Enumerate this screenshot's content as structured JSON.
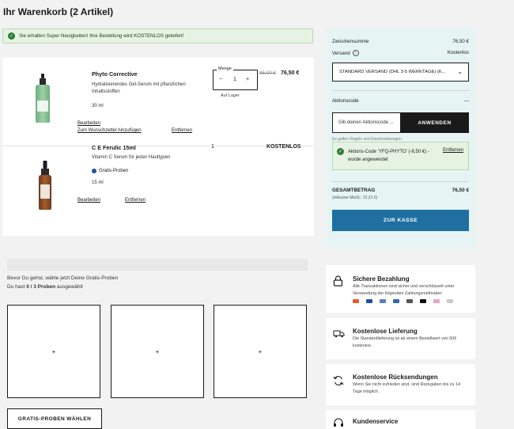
{
  "page_title": "Ihr Warenkorb (2 Artikel)",
  "notice": "Sie erhalten Super Neuigkeiten! Ihre Bestellung wird KOSTENLOS geliefert!",
  "items": [
    {
      "name": "Phyto Corrective",
      "description": "Hydratisierendes Gel-Serum mit pflanzlichen Inhaltsstoffen",
      "size": "30 ml",
      "qty_legend": "Menge",
      "qty_minus": "−",
      "qty": "1",
      "qty_plus": "+",
      "stock": "Auf Lager",
      "price_old": "85,00 €",
      "price_new": "76,50 €",
      "edit": "Bearbeiten",
      "wishlist": "Zum Wunschzettel hinzufügen",
      "remove": "Entfernen"
    },
    {
      "name": "C E Ferulic 15ml",
      "description": "Vitamin C Serum für jeden Hauttypen",
      "badge": "Gratis-Proben",
      "size": "15 ml",
      "qty": "1",
      "price": "KOSTENLOS",
      "edit": "Bearbeiten",
      "remove": "Entfernen"
    }
  ],
  "summary": {
    "subtotal_label": "Zwischensumme",
    "subtotal_value": "76,50 €",
    "shipping_label": "Versand",
    "shipping_value": "Kostenlos",
    "shipping_option": "STANDARD VERSAND (DHL 3-5 WERKTAGE) (K...",
    "promo_label": "Aktionscode",
    "promo_toggle": "—",
    "promo_placeholder": "Gib deinen Aktionscode ...",
    "apply_label": "ANWENDEN",
    "terms_note": "Es gelten Regeln und Einschränkungen",
    "applied_text": "Aktions-Code 'YFQ-PHYTO' (-8,50 €) - wurde angewendet",
    "applied_remove": "Entfernen",
    "total_label": "GESAMTBETRAG",
    "total_value": "76,50 €",
    "vat_note": "(inklusive MwSt.: 12,21 €)",
    "checkout_label": "ZUR KASSE"
  },
  "samples": {
    "intro": "Bevor Du gehst, wähle jetzt Deine Gratis-Proben",
    "count_prefix": "Du hast ",
    "count_value": "0 / 3 Proben",
    "count_suffix": " ausgewählt",
    "slot_plus": "+",
    "button_label": "GRATIS-PROBEN WÄHLEN"
  },
  "features": [
    {
      "title": "Sichere Bezahlung",
      "description": "Alle Transaktionen sind sicher und verschlüsselt unter Verwendung der folgenden Zahlungsmethoden:"
    },
    {
      "title": "Kostenlose Lieferung",
      "description": "Die Standardlieferung ist ab einem Bestellwert von 50€ kostenlos."
    },
    {
      "title": "Kostenlose Rücksendungen",
      "description": "Wenn Sie nicht zufrieden sind, sind Rückgaben bis zu 14 Tage möglich."
    },
    {
      "title": "Kundenservice"
    }
  ],
  "colors": {
    "summary_bg": "#e6f5f4",
    "checkout": "#1f6fa0",
    "success": "#2e7d32",
    "notice_bg": "#e6f3e2"
  }
}
